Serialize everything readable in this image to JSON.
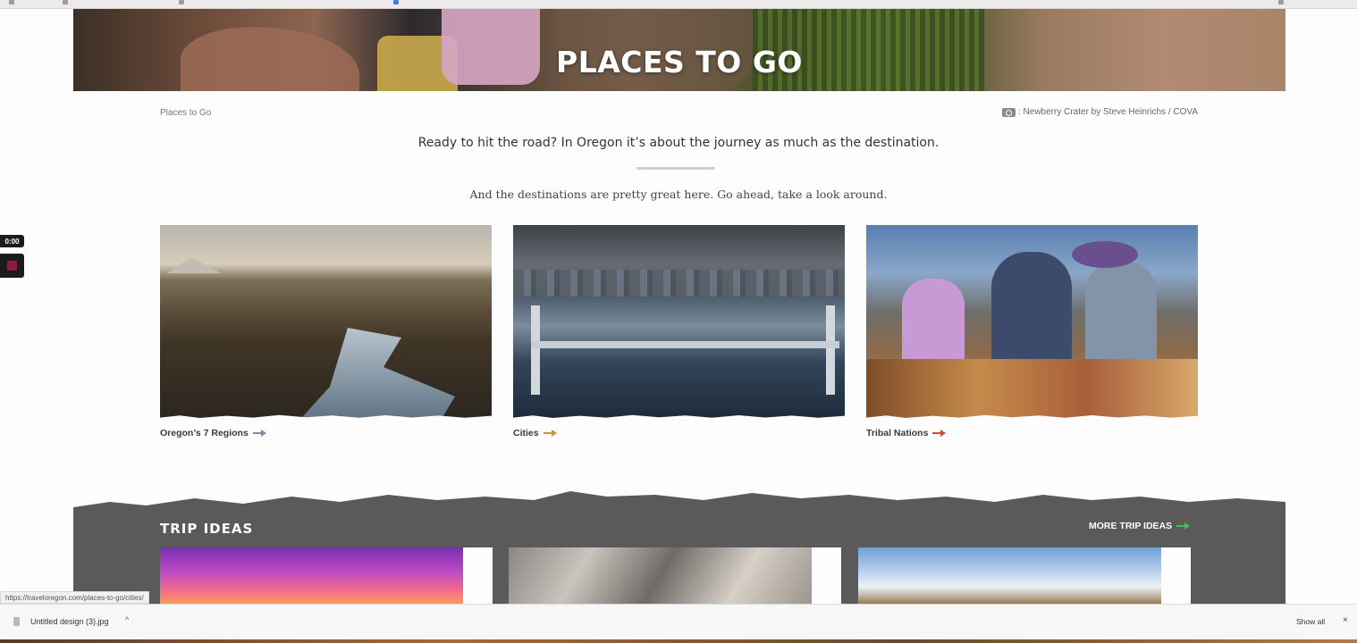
{
  "hero": {
    "title": "PLACES TO GO"
  },
  "breadcrumb": "Places to Go",
  "photo_credit": ": Newberry Crater by Steve Heinrichs / COVA",
  "intro": {
    "lead": "Ready to hit the road? In Oregon it’s about the journey as much as the destination.",
    "sub": "And the destinations are pretty great here. Go ahead, take a look around."
  },
  "cards": [
    {
      "label": "Oregon’s 7 Regions",
      "arrow_color": "#7a8ea0"
    },
    {
      "label": "Cities",
      "arrow_color": "#c8962e"
    },
    {
      "label": "Tribal Nations",
      "arrow_color": "#d6453a"
    }
  ],
  "trip_ideas": {
    "title": "TRIP IDEAS",
    "more_label": "MORE TRIP IDEAS",
    "arrow_color": "#3fbf5f"
  },
  "recorder": {
    "time": "0:00"
  },
  "status_url": "https://traveloregon.com/places-to-go/cities/",
  "downloads": {
    "file_name": "Untitled design (3).jpg",
    "show_all": "Show all",
    "close": "×"
  }
}
